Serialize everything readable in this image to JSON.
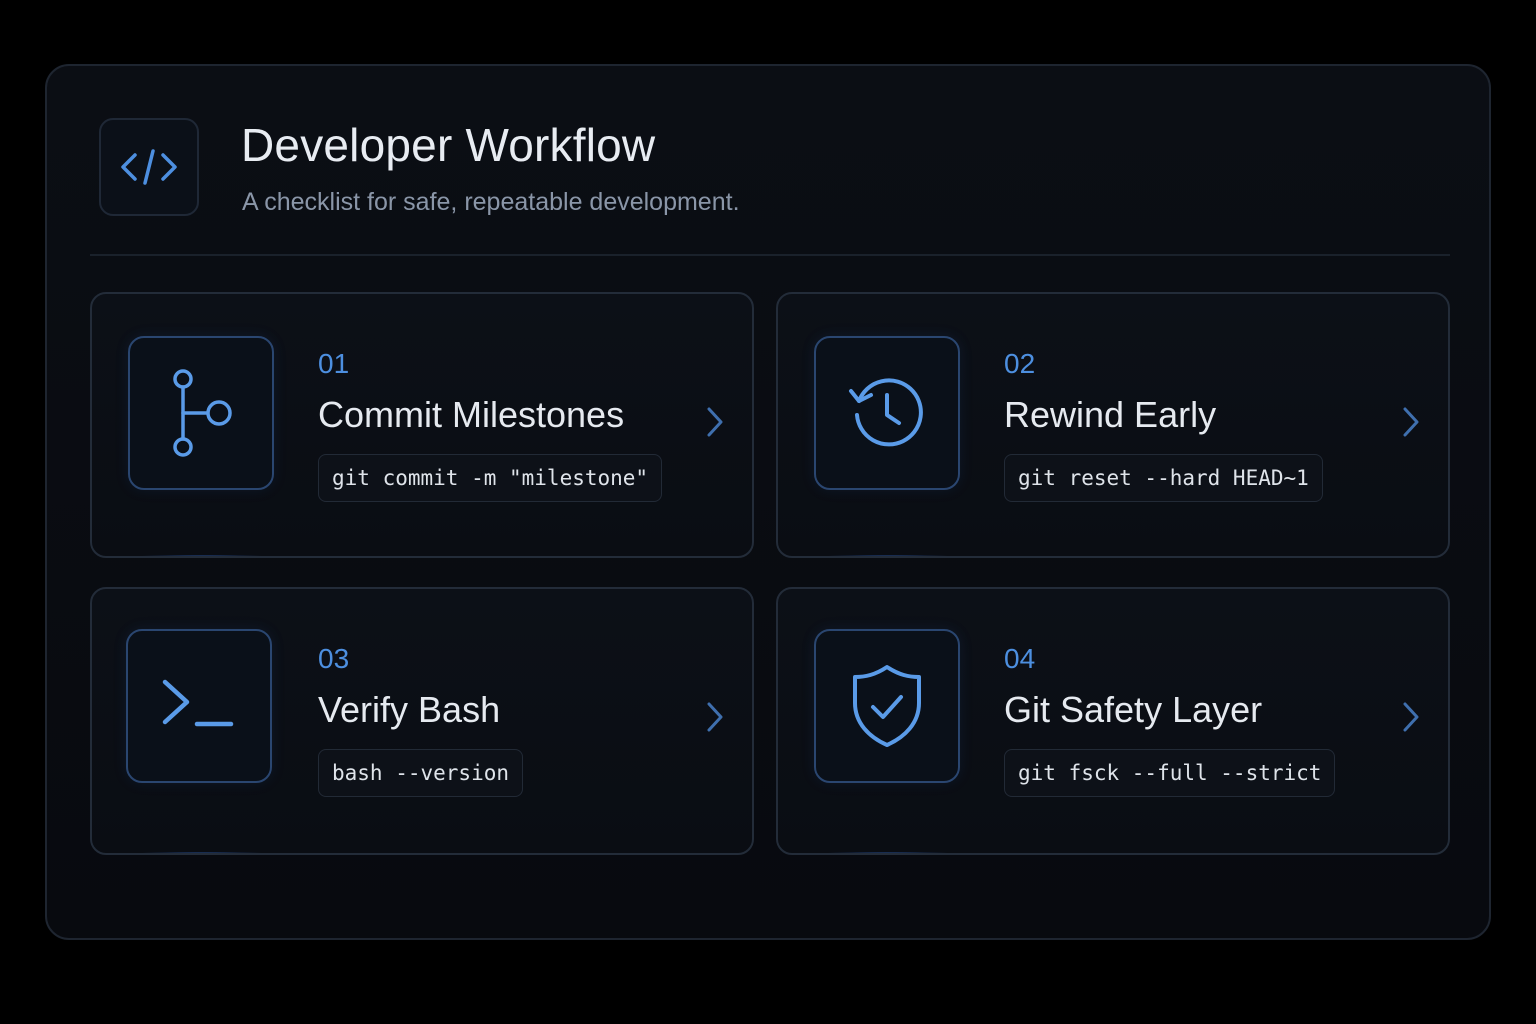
{
  "header": {
    "title": "Developer Workflow",
    "subtitle": "A checklist for safe, repeatable development.",
    "logo_icon": "code-brackets-icon"
  },
  "accent_color": "#4d8fe0",
  "cards": [
    {
      "number": "01",
      "title": "Commit Milestones",
      "command": "git commit -m \"milestone\"",
      "icon": "git-commit-branch-icon"
    },
    {
      "number": "02",
      "title": "Rewind Early",
      "command": "git reset --hard HEAD~1",
      "icon": "history-rewind-icon"
    },
    {
      "number": "03",
      "title": "Verify Bash",
      "command": "bash --version",
      "icon": "terminal-prompt-icon"
    },
    {
      "number": "04",
      "title": "Git Safety Layer",
      "command": "git fsck --full --strict",
      "icon": "shield-check-icon"
    }
  ]
}
